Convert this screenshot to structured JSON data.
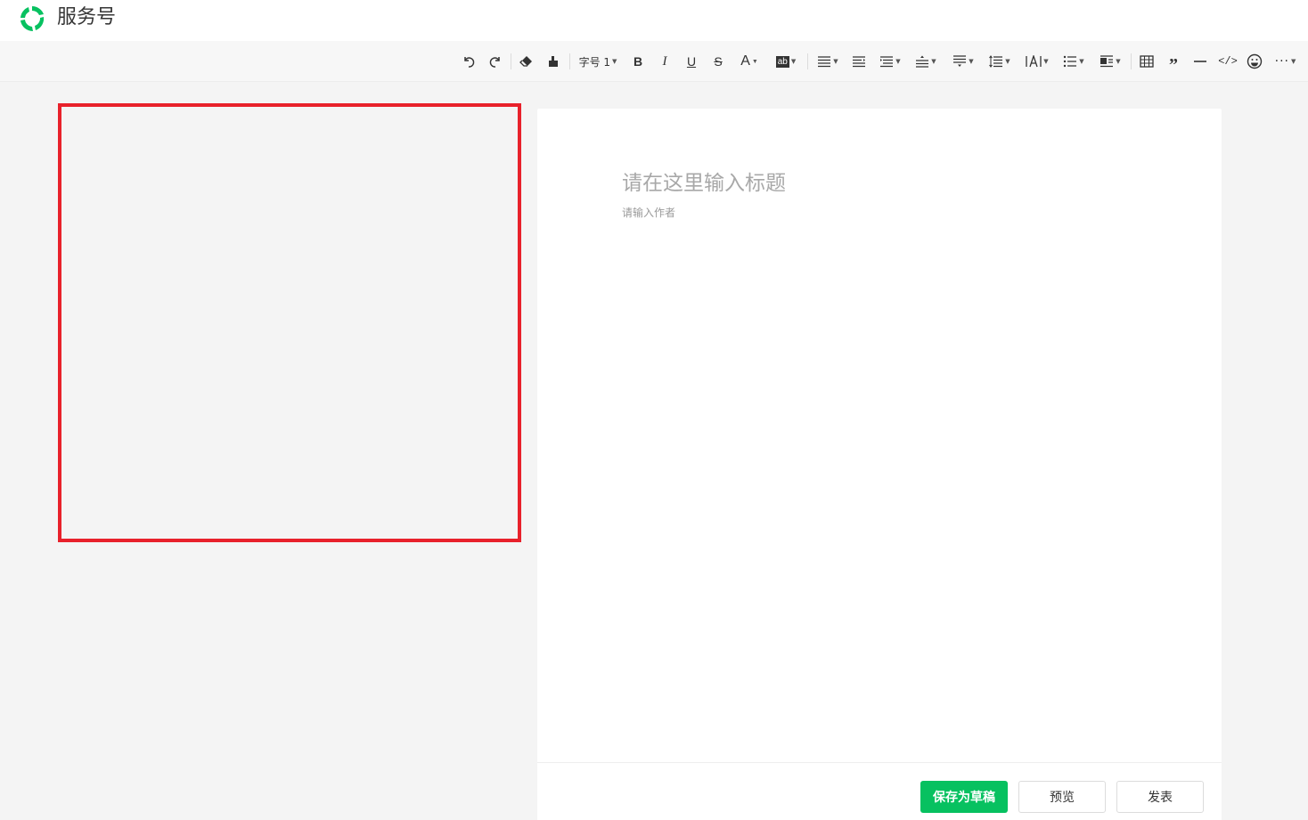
{
  "app": {
    "title": "服务号"
  },
  "toolbar": {
    "font_size_label": "字号 1",
    "highlight_label": "ab"
  },
  "editor": {
    "title_placeholder": "请在这里输入标题",
    "author_placeholder": "请输入作者"
  },
  "footer": {
    "save_draft_label": "保存为草稿",
    "preview_label": "预览",
    "publish_label": "发表"
  },
  "colors": {
    "brand_green": "#07c160",
    "highlight_box": "#e8212b"
  }
}
